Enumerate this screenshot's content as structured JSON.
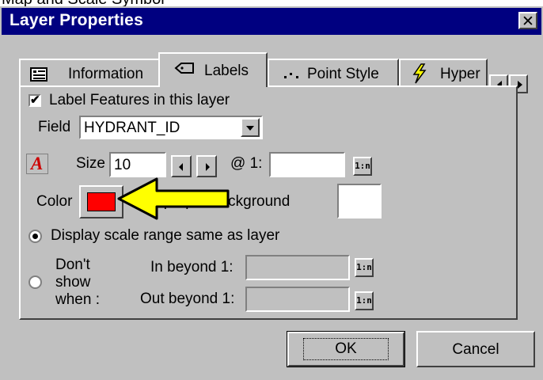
{
  "top_strip_text": "Map and Scale Symbol",
  "dialog": {
    "title": "Layer Properties",
    "close_glyph": "✕"
  },
  "tabs": [
    {
      "label": "Information",
      "icon": "info-icon"
    },
    {
      "label": "Labels",
      "icon": "label-icon",
      "active": true
    },
    {
      "label": "Point Style",
      "icon": "point-style-icon"
    },
    {
      "label": "Hyper",
      "icon": "lightning-icon"
    }
  ],
  "labels_panel": {
    "label_features": {
      "label": "Label Features in this layer",
      "checked": true
    },
    "field": {
      "label": "Field",
      "value": "HYDRANT_ID"
    },
    "size": {
      "label": "Size",
      "value": "10"
    },
    "scale": {
      "label": "@ 1:",
      "value": ""
    },
    "scale_button": "1:n",
    "color": {
      "label": "Color",
      "swatch": "#ff0000"
    },
    "opaque_background": {
      "label": "Opaque Background",
      "swatch": "#ffffff"
    },
    "display_scale": {
      "label": "Display scale range same as layer",
      "selected": true
    },
    "dont_show": {
      "line1": "Don't",
      "line2": "show",
      "line3": "when :",
      "selected": false
    },
    "in_beyond": {
      "label": "In beyond 1:",
      "value": ""
    },
    "out_beyond": {
      "label": "Out beyond 1:",
      "value": ""
    }
  },
  "buttons": {
    "ok": "OK",
    "cancel": "Cancel"
  },
  "colors": {
    "titlebar": "#000080",
    "face": "#c0c0c0",
    "arrow": "#ffff00"
  }
}
